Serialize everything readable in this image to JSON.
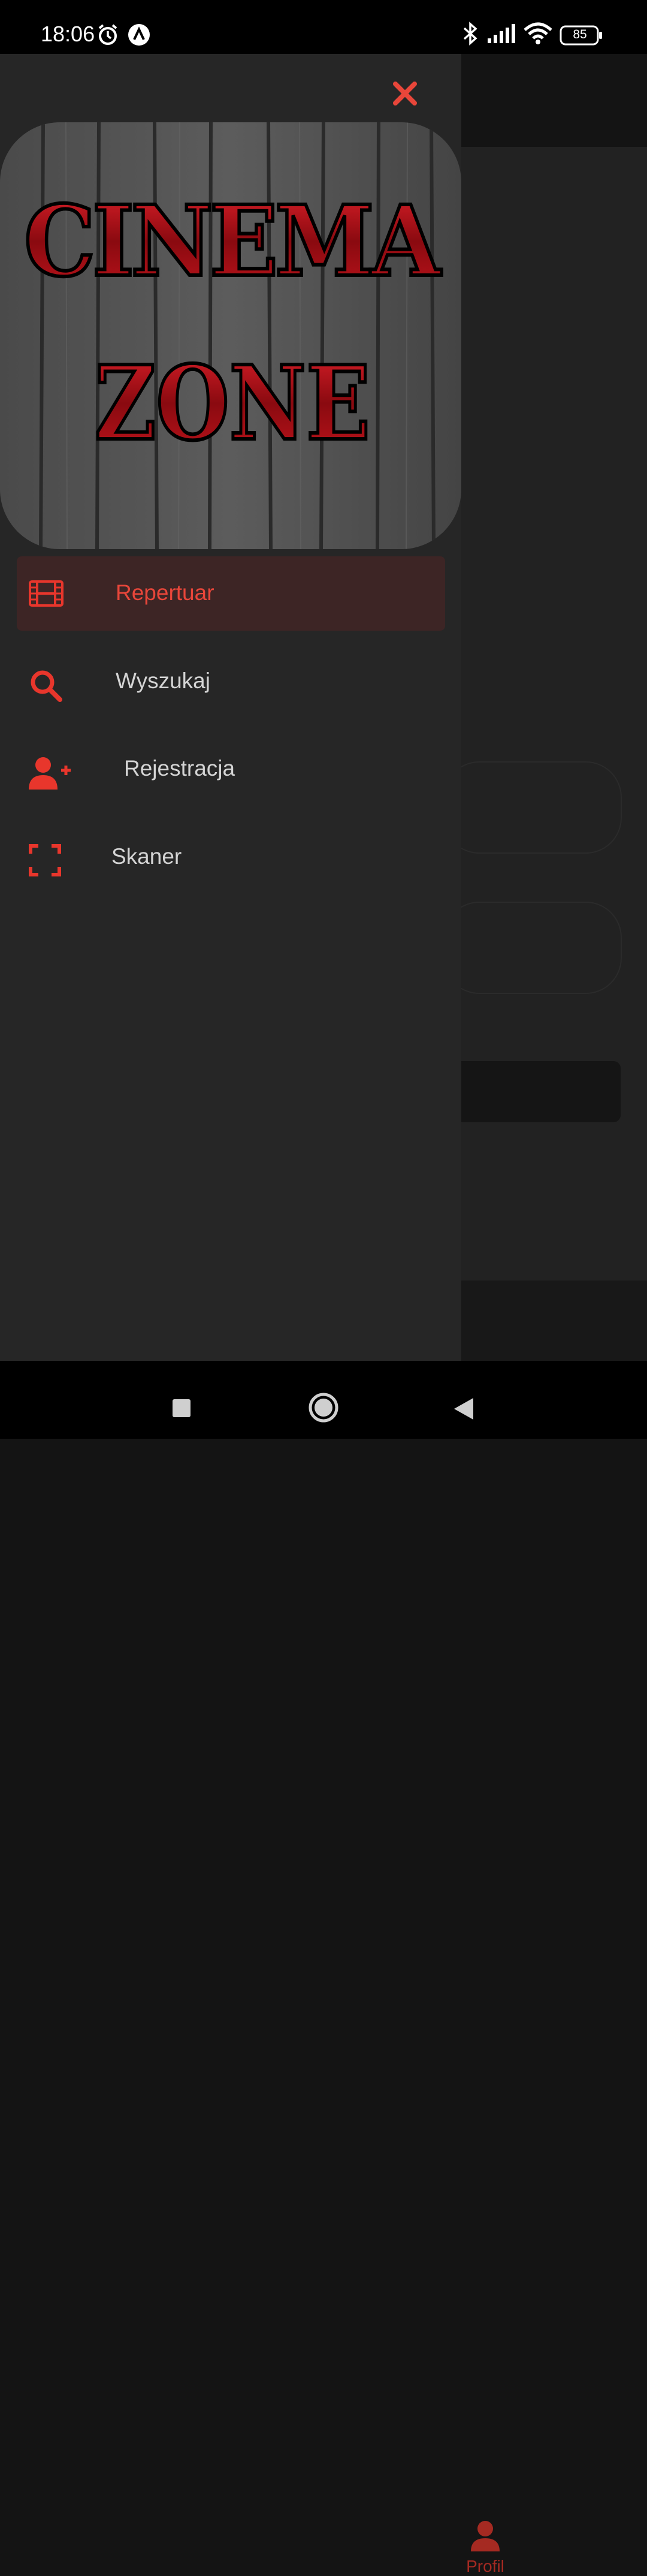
{
  "status_bar": {
    "time": "18:06",
    "battery": "85",
    "icons": [
      "alarm-icon",
      "app-notification-icon",
      "bluetooth-icon",
      "signal-icon",
      "wifi-icon",
      "battery-icon"
    ]
  },
  "drawer": {
    "close_icon": "close-icon",
    "logo": {
      "line1": "CINEMA",
      "line2": "ZONE"
    },
    "menu": [
      {
        "label": "Repertuar",
        "icon": "film-icon",
        "active": true
      },
      {
        "label": "Wyszukaj",
        "icon": "search-icon",
        "active": false
      },
      {
        "label": "Rejestracja",
        "icon": "user-plus-icon",
        "active": false
      },
      {
        "label": "Skaner",
        "icon": "scanner-icon",
        "active": false
      }
    ]
  },
  "background_app": {
    "bottom_nav": {
      "profile_label": "Profil",
      "profile_icon": "user-icon"
    }
  },
  "nav_bar": {
    "icons": [
      "recents-icon",
      "home-icon",
      "back-icon"
    ]
  },
  "colors": {
    "accent": "#e8362c",
    "drawer_bg": "#262626",
    "active_item_bg": "#3d2525",
    "text": "#d4d4d4"
  }
}
